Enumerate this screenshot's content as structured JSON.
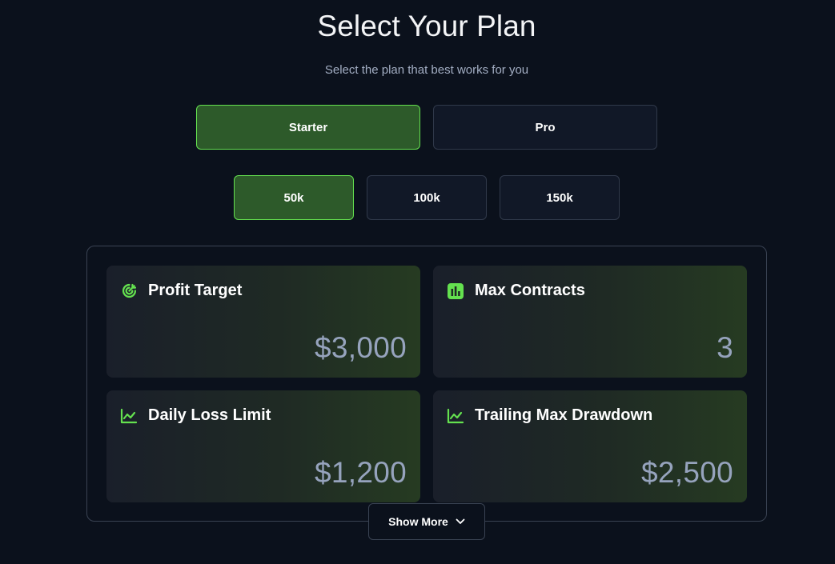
{
  "header": {
    "title": "Select Your Plan",
    "subtitle": "Select the plan that best works for you"
  },
  "plans": {
    "options": [
      {
        "label": "Starter",
        "selected": true
      },
      {
        "label": "Pro",
        "selected": false
      }
    ]
  },
  "account_sizes": {
    "options": [
      {
        "label": "50k",
        "selected": true
      },
      {
        "label": "100k",
        "selected": false
      },
      {
        "label": "150k",
        "selected": false
      }
    ]
  },
  "metrics": [
    {
      "label": "Profit Target",
      "value": "$3,000",
      "icon": "target-icon"
    },
    {
      "label": "Max Contracts",
      "value": "3",
      "icon": "bar-chart-icon"
    },
    {
      "label": "Daily Loss Limit",
      "value": "$1,200",
      "icon": "line-chart-icon"
    },
    {
      "label": "Trailing Max Drawdown",
      "value": "$2,500",
      "icon": "line-chart-icon"
    }
  ],
  "show_more": {
    "label": "Show More",
    "icon": "chevron-down-icon"
  },
  "colors": {
    "background": "#0b111c",
    "accent": "#64e14f",
    "active_fill": "#2d5a2a",
    "value_text": "#96a3bd"
  }
}
